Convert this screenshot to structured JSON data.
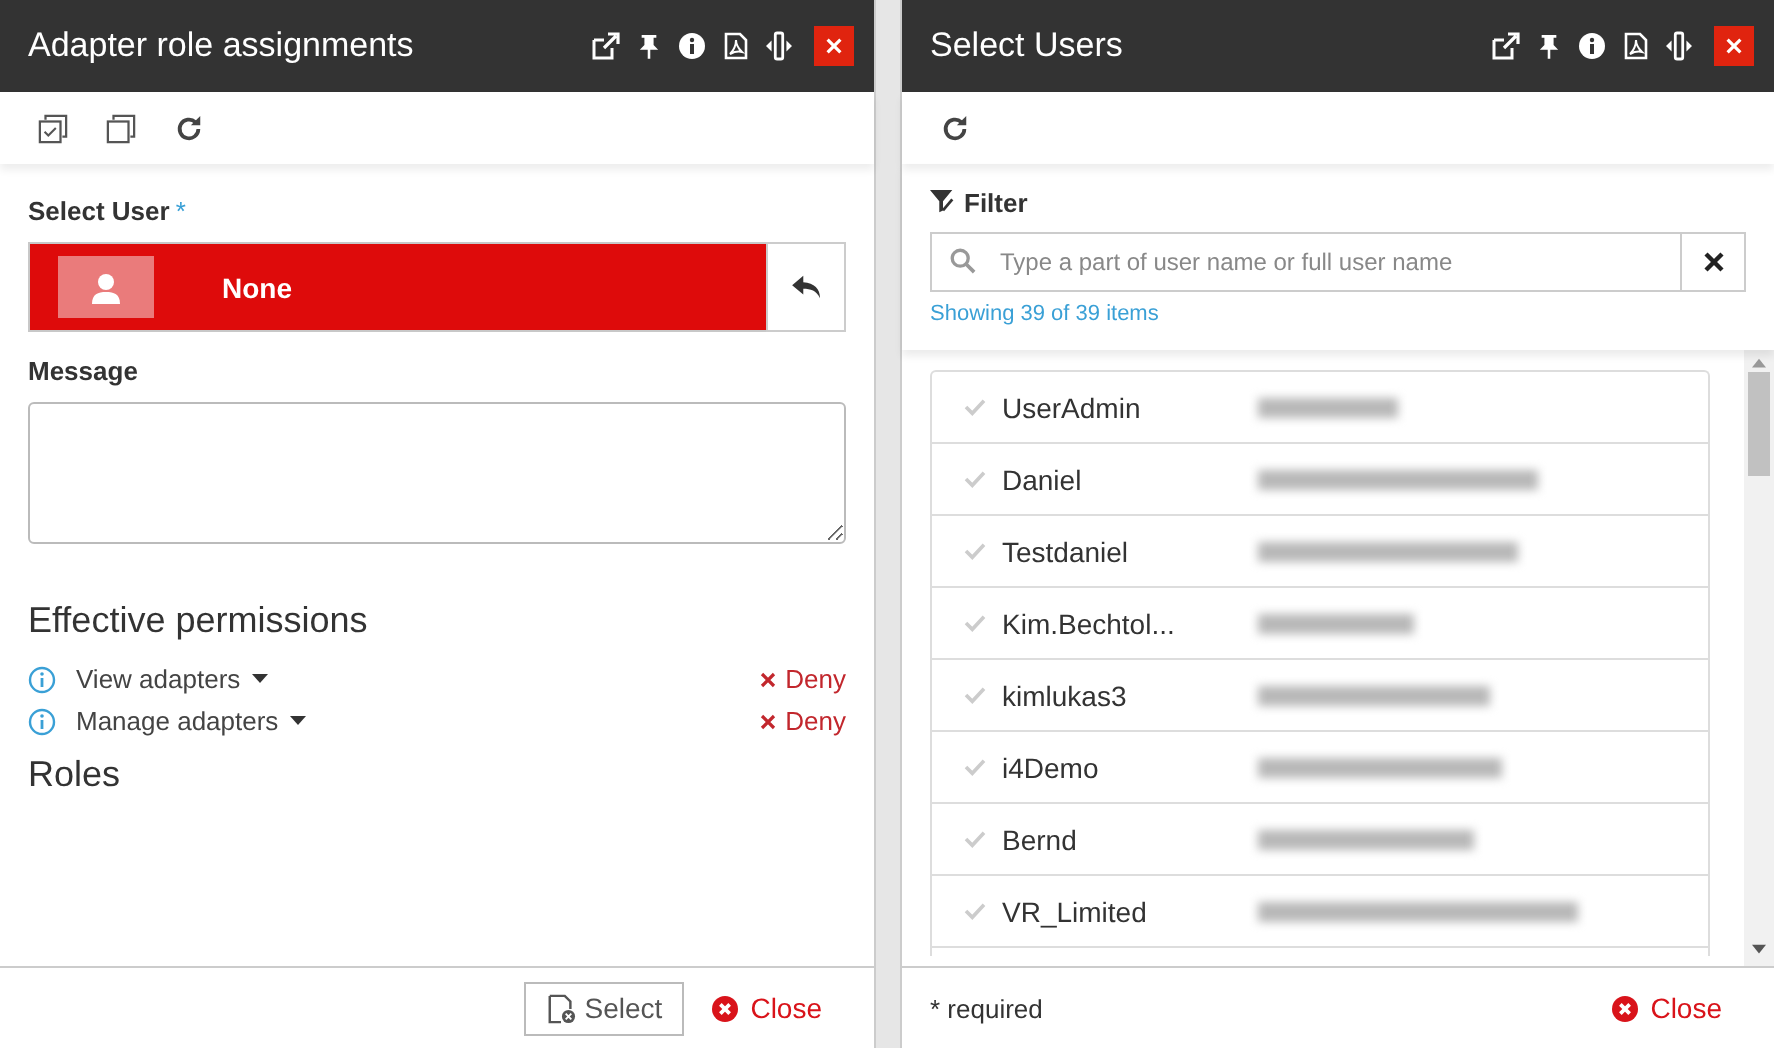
{
  "left_window": {
    "title": "Adapter role assignments",
    "select_user": {
      "label": "Select User",
      "required_mark": "*",
      "value": "None"
    },
    "message": {
      "label": "Message"
    },
    "permissions_heading": "Effective permissions",
    "permissions": [
      {
        "name": "View adapters",
        "result": "Deny"
      },
      {
        "name": "Manage adapters",
        "result": "Deny"
      }
    ],
    "roles_heading": "Roles",
    "buttons": [
      "Select",
      "Close"
    ]
  },
  "right_window": {
    "title": "Select Users",
    "filter": {
      "label": "Filter",
      "placeholder": "Type a part of user name or full user name",
      "count": "Showing 39 of 39 items"
    },
    "users": [
      {
        "username": "UserAdmin"
      },
      {
        "username": "Daniel"
      },
      {
        "username": "Testdaniel"
      },
      {
        "username": "Kim.Bechtol..."
      },
      {
        "username": "kimlukas3"
      },
      {
        "username": "i4Demo"
      },
      {
        "username": "Bernd"
      },
      {
        "username": "VR_Limited"
      }
    ],
    "required_note": "* required",
    "close_button": "Close"
  }
}
